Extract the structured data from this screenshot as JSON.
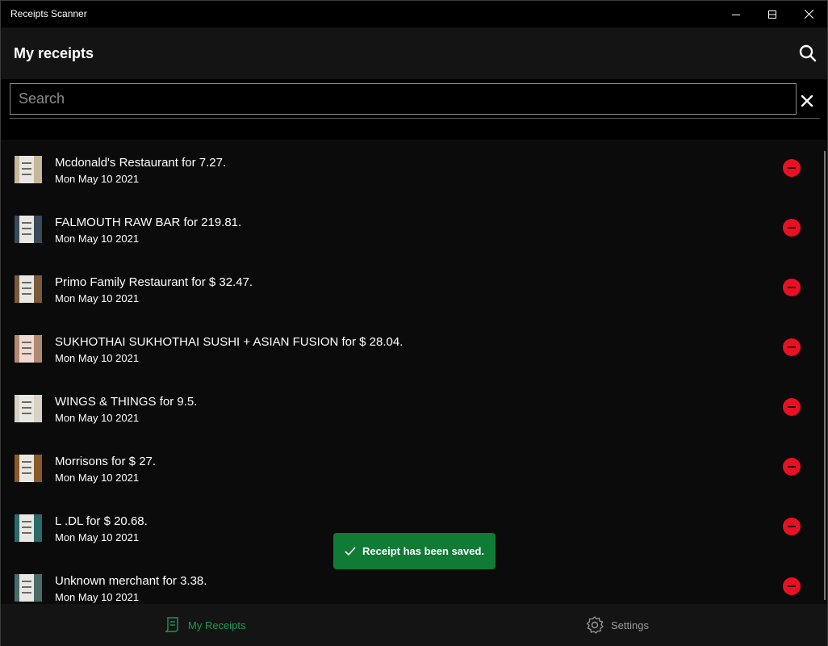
{
  "window": {
    "title": "Receipts Scanner"
  },
  "header": {
    "title": "My receipts",
    "search_icon": "search-icon"
  },
  "search": {
    "placeholder": "Search",
    "value": ""
  },
  "receipts": [
    {
      "name": "Mcdonald's Restaurant for 7.27.",
      "date": "Mon May 10 2021"
    },
    {
      "name": "FALMOUTH RAW BAR for 219.81.",
      "date": "Mon May 10 2021"
    },
    {
      "name": "Primo Family Restaurant for $ 32.47.",
      "date": "Mon May 10 2021"
    },
    {
      "name": "SUKHOTHAI SUKHOTHAI SUSHI + ASIAN FUSION for $ 28.04.",
      "date": "Mon May 10 2021"
    },
    {
      "name": "WINGS & THINGS for 9.5.",
      "date": "Mon May 10 2021"
    },
    {
      "name": "Morrisons for $ 27.",
      "date": "Mon May 10 2021"
    },
    {
      "name": "L .DL for $ 20.68.",
      "date": "Mon May 10 2021"
    },
    {
      "name": "Unknown merchant for 3.38.",
      "date": "Mon May 10 2021"
    }
  ],
  "toast": {
    "message": "Receipt has been saved."
  },
  "nav": {
    "receipts_label": "My Receipts",
    "settings_label": "Settings"
  },
  "colors": {
    "accent": "#1b9a55",
    "toast_bg": "#0f7b35",
    "delete": "#e81123"
  }
}
